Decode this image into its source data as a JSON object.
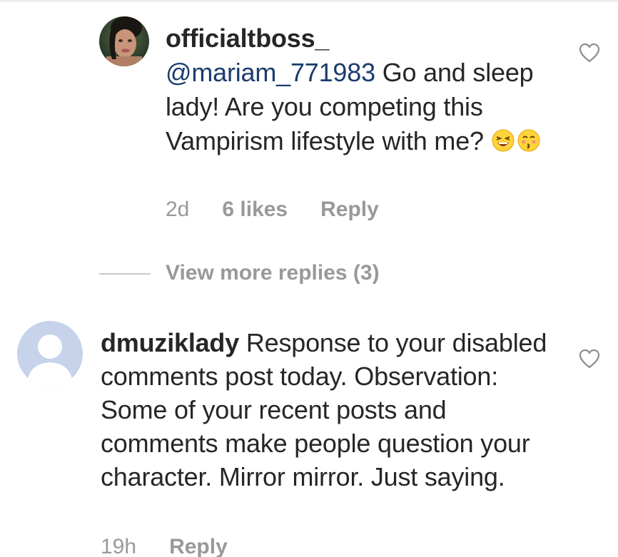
{
  "reply": {
    "username": "officialtboss_",
    "mention": "@mariam_771983",
    "text": " Go and sleep lady! Are you competing this Vampirism lifestyle with me?",
    "emojis": [
      "grinning-squint-emoji",
      "kissing-face-emoji"
    ],
    "time": "2d",
    "likes": "6 likes",
    "reply_label": "Reply"
  },
  "view_more": {
    "label": "View more replies (3)"
  },
  "comment": {
    "username": "dmuziklady",
    "text": " Response to your disabled comments post today. Observation: Some of your recent posts and comments make people question your character. Mirror mirror. Just saying.",
    "time": "19h",
    "reply_label": "Reply"
  },
  "colors": {
    "mention": "#1b3b6d",
    "meta": "#999999",
    "avatar_placeholder": "#c6d3ea"
  }
}
